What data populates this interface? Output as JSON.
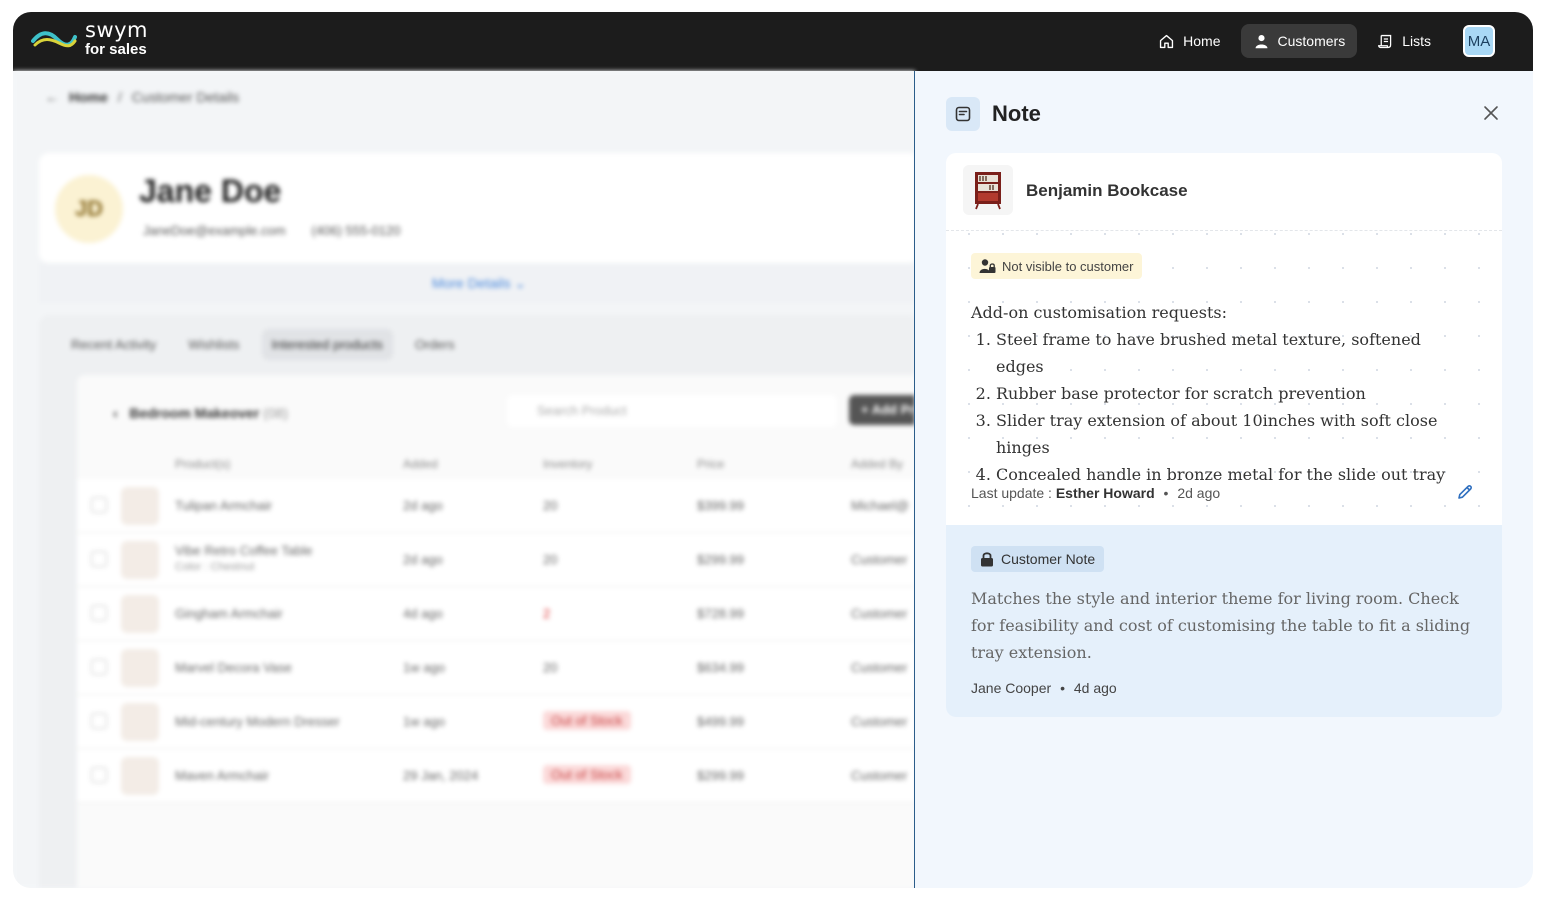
{
  "app": {
    "logo_line1": "swym",
    "logo_line2": "for sales"
  },
  "nav": {
    "home": "Home",
    "customers": "Customers",
    "lists": "Lists",
    "avatar": "MA"
  },
  "background": {
    "breadcrumb_home": "Home",
    "breadcrumb_sep": "/",
    "breadcrumb_current": "Customer Details",
    "initials": "JD",
    "name": "Jane Doe",
    "email": "JaneDoe@example.com",
    "phone": "(406) 555-0120",
    "more_details": "More Details",
    "tabs": [
      "Recent Activity",
      "Wishlists",
      "Interested products",
      "Orders"
    ],
    "list_title": "Bedroom Makeover",
    "list_count": "(08)",
    "search_placeholder": "Search Product",
    "add_product": "+ Add Product",
    "columns": [
      "Product(s)",
      "Added",
      "Inventory",
      "Price",
      "Added By"
    ],
    "rows": [
      {
        "name": "Tulipan Armchair",
        "sub": "",
        "added": "2d ago",
        "inventory": "20",
        "price": "$399.99",
        "by": "Michael@"
      },
      {
        "name": "Vibe Retro Coffee Table",
        "sub": "Color : Chestnut",
        "added": "2d ago",
        "inventory": "20",
        "price": "$299.99",
        "by": "Customer"
      },
      {
        "name": "Gingham Armchair",
        "sub": "",
        "added": "4d ago",
        "inventory": "2",
        "price": "$728.99",
        "by": "Customer"
      },
      {
        "name": "Marvel Decora Vase",
        "sub": "",
        "added": "1w ago",
        "inventory": "20",
        "price": "$634.99",
        "by": "Customer"
      },
      {
        "name": "Mid-century Modern Dresser",
        "sub": "",
        "added": "1w ago",
        "inventory": "Out of Stock",
        "price": "$499.99",
        "by": "Customer"
      },
      {
        "name": "Maven Armchair",
        "sub": "",
        "added": "29 Jan, 2024",
        "inventory": "Out of Stock",
        "price": "$299.99",
        "by": "Customer"
      }
    ]
  },
  "panel": {
    "title": "Note",
    "product_name": "Benjamin Bookcase",
    "visibility_badge": "Not visible to customer",
    "note_intro": "Add-on customisation requests:",
    "note_items": [
      "Steel frame to have brushed metal texture, softened edges",
      "Rubber base protector for scratch prevention",
      "Slider tray extension of about 10inches with soft close hinges",
      "Concealed handle in bronze metal for the slide out tray"
    ],
    "last_update_label": "Last update :",
    "last_update_author": "Esther Howard",
    "last_update_sep": "•",
    "last_update_time": "2d ago",
    "customer_note_badge": "Customer Note",
    "customer_note_text": "Matches the style and interior theme for living room. Check for feasibility and cost of customising the table to fit a sliding tray extension.",
    "customer_note_author": "Jane Cooper",
    "customer_note_sep": "•",
    "customer_note_time": "4d ago"
  },
  "colors": {
    "topbar": "#1c1c1c",
    "panel_bg": "#f2f7fd",
    "customer_section": "#e5f0fb",
    "badge_yellow": "#fdf5d8",
    "accent_blue": "#2f6fbf"
  }
}
